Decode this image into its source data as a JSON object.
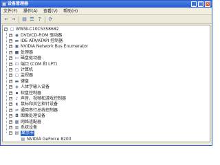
{
  "window": {
    "title": "设备管理器",
    "minimize": "_",
    "maximize": "□",
    "close": "×"
  },
  "menu": [
    "文件(F)",
    "操作(A)",
    "查看(V)",
    "帮助(H)"
  ],
  "toolbar": {
    "back": "←",
    "forward": "→",
    "tree_view": "▤",
    "properties": "☰",
    "help": "?",
    "scan": "⟳"
  },
  "tree": {
    "root": "WWW-C10C5358682",
    "items": [
      {
        "label": "DVD/CD-ROM 驱动器",
        "icon": "cdrom-icon",
        "glyph": "◉",
        "expander": "+"
      },
      {
        "label": "IDE ATA/ATAPI 控制器",
        "icon": "ide-controller-icon",
        "glyph": "▬",
        "expander": "+"
      },
      {
        "label": "NVIDIA Network Bus Enumerator",
        "icon": "network-bus-icon",
        "glyph": "▣",
        "expander": "+"
      },
      {
        "label": "处理器",
        "icon": "processor-icon",
        "glyph": "■",
        "expander": "+"
      },
      {
        "label": "磁盘驱动器",
        "icon": "disk-drive-icon",
        "glyph": "▭",
        "expander": "+"
      },
      {
        "label": "端口 (COM 和 LPT)",
        "icon": "port-icon",
        "glyph": "⊡",
        "expander": "+"
      },
      {
        "label": "计算机",
        "icon": "computer-icon",
        "glyph": "▢",
        "expander": "+"
      },
      {
        "label": "监视器",
        "icon": "monitor-icon",
        "glyph": "▢",
        "expander": "+"
      },
      {
        "label": "键盘",
        "icon": "keyboard-icon",
        "glyph": "▬",
        "expander": "+"
      },
      {
        "label": "人体学输入设备",
        "icon": "hid-icon",
        "glyph": "◈",
        "expander": "+"
      },
      {
        "label": "软盘控制器",
        "icon": "floppy-controller-icon",
        "glyph": "▪",
        "expander": "+"
      },
      {
        "label": "声音、视频和游戏控制器",
        "icon": "sound-icon",
        "glyph": "♪",
        "expander": "+"
      },
      {
        "label": "鼠标和其它指针设备",
        "icon": "mouse-icon",
        "glyph": "◖",
        "expander": "+"
      },
      {
        "label": "通用串行总线控制器",
        "icon": "usb-icon",
        "glyph": "⇌",
        "expander": "+"
      },
      {
        "label": "图像处理设备",
        "icon": "imaging-device-icon",
        "glyph": "◘",
        "expander": "+"
      },
      {
        "label": "网络适配器",
        "icon": "network-adapter-icon",
        "glyph": "▦",
        "expander": "+"
      },
      {
        "label": "系统设备",
        "icon": "system-device-icon",
        "glyph": "▥",
        "expander": "+"
      },
      {
        "label": "显示卡",
        "icon": "display-adapter-icon",
        "glyph": "▤",
        "expander": "−",
        "selected": true
      }
    ],
    "child": {
      "label": "NVIDIA GeForce 8200",
      "icon": "display-card-icon",
      "glyph": "▤"
    }
  },
  "colors": {
    "titlebar": "#2458d3",
    "selection": "#316ac5",
    "window_bg": "#ece9d8"
  }
}
